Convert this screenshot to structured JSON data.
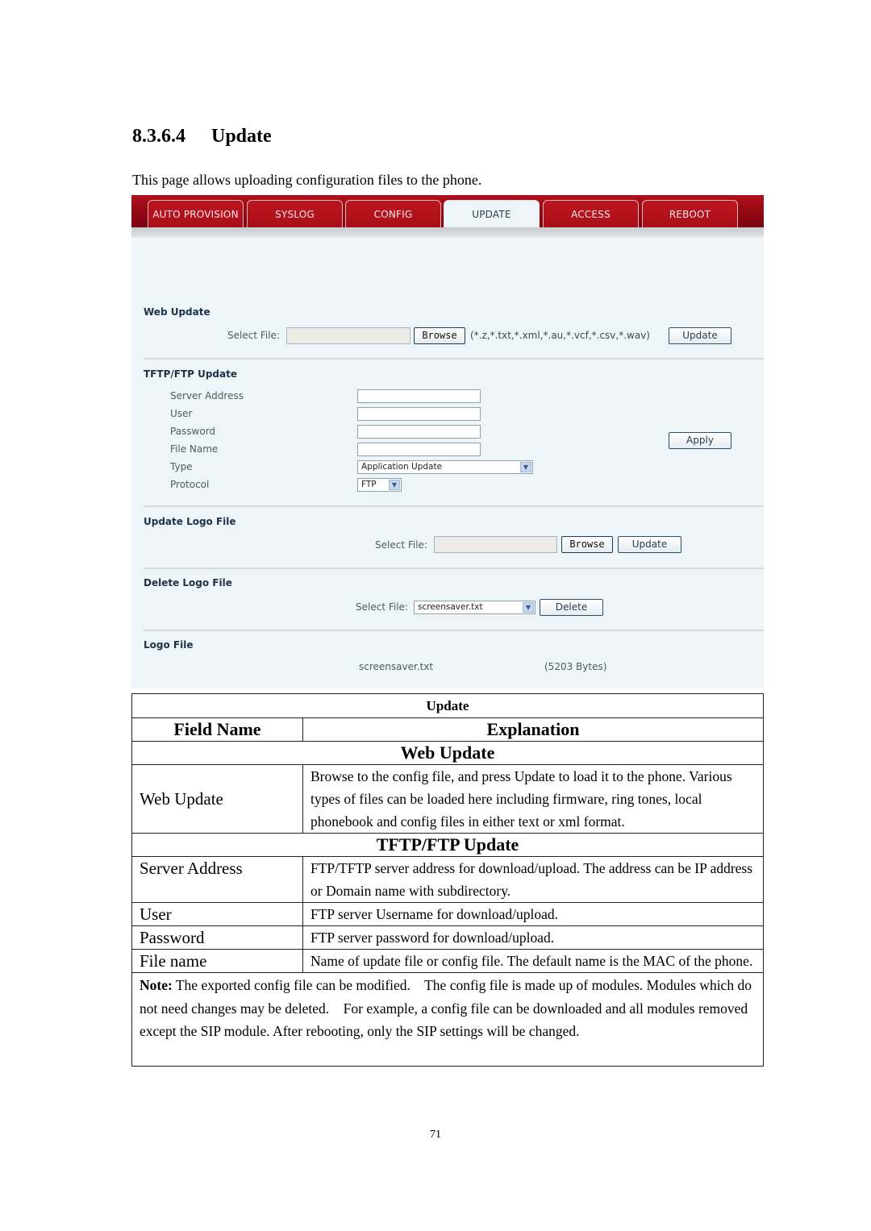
{
  "doc": {
    "section_number": "8.3.6.4",
    "section_title": "Update",
    "intro": "This page allows uploading configuration files to the phone.",
    "page_number": "71"
  },
  "screenshot": {
    "tabs": [
      {
        "label": "AUTO PROVISION",
        "active": false
      },
      {
        "label": "SYSLOG",
        "active": false
      },
      {
        "label": "CONFIG",
        "active": false
      },
      {
        "label": "UPDATE",
        "active": true
      },
      {
        "label": "ACCESS",
        "active": false
      },
      {
        "label": "REBOOT",
        "active": false
      }
    ],
    "web_update": {
      "title": "Web Update",
      "select_file_label": "Select File:",
      "file_value": "",
      "browse_label": "Browse",
      "extensions_hint": "(*.z,*.txt,*.xml,*.au,*.vcf,*.csv,*.wav)",
      "update_label": "Update"
    },
    "tftp_update": {
      "title": "TFTP/FTP Update",
      "server_address_label": "Server Address",
      "server_address_value": "",
      "user_label": "User",
      "user_value": "",
      "password_label": "Password",
      "password_value": "",
      "file_name_label": "File Name",
      "file_name_value": "",
      "type_label": "Type",
      "type_value": "Application Update",
      "protocol_label": "Protocol",
      "protocol_value": "FTP",
      "apply_label": "Apply"
    },
    "update_logo": {
      "title": "Update Logo File",
      "select_file_label": "Select File:",
      "file_value": "",
      "browse_label": "Browse",
      "update_label": "Update"
    },
    "delete_logo": {
      "title": "Delete Logo File",
      "select_file_label": "Select File:",
      "file_value": "screensaver.txt",
      "delete_label": "Delete"
    },
    "logo_file": {
      "title": "Logo File",
      "file_name": "screensaver.txt",
      "file_size": "(5203 Bytes)"
    },
    "colors": {
      "nav_red": "#a80e18",
      "panel_bg": "#eef5f8",
      "section_title": "#1f3147"
    }
  },
  "table": {
    "title": "Update",
    "col_field": "Field Name",
    "col_explanation": "Explanation",
    "groups": [
      {
        "name": "Web Update",
        "rows": [
          {
            "field": "Web Update",
            "explanation": "Browse to the config file, and press Update to load it to the phone. Various types of files can be loaded here including firmware, ring tones, local phonebook and config files in either text or xml format."
          }
        ]
      },
      {
        "name": "TFTP/FTP Update",
        "rows": [
          {
            "field": "Server Address",
            "explanation": "FTP/TFTP server address for download/upload. The address can be IP address or Domain name with subdirectory."
          },
          {
            "field": "User",
            "explanation": "FTP server Username for download/upload."
          },
          {
            "field": "Password",
            "explanation": "FTP server password for download/upload."
          },
          {
            "field": "File name",
            "explanation": "Name of update file or config file. The default name is the MAC of the phone."
          }
        ]
      }
    ],
    "note_label": "Note:",
    "note_text": " The exported config file can be modified.    The config file is made up of modules. Modules which do not need changes may be deleted.    For example, a config file can be downloaded and all modules removed except the SIP module. After rebooting, only the SIP settings will be changed."
  }
}
